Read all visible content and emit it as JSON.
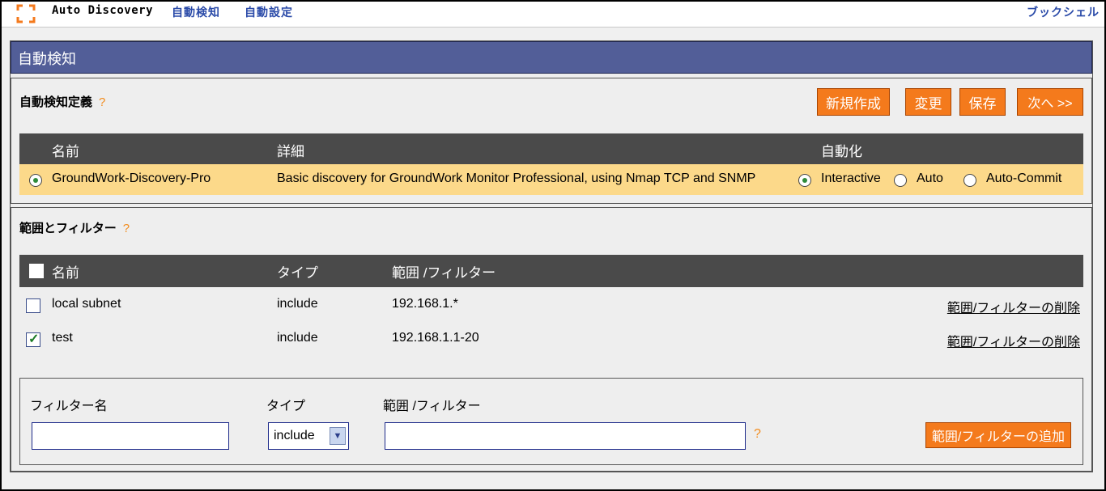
{
  "header": {
    "app_title": "Auto Discovery",
    "nav": [
      "自動検知",
      "自動設定"
    ],
    "bookshelf": "ブックシェル"
  },
  "page_title": "自動検知",
  "definition": {
    "title": "自動検知定義",
    "help": "?",
    "buttons": {
      "new": "新規作成",
      "edit": "変更",
      "save": "保存",
      "next": "次へ >>"
    },
    "columns": {
      "name": "名前",
      "detail": "詳細",
      "automation": "自動化"
    },
    "row": {
      "name": "GroundWork-Discovery-Pro",
      "detail": "Basic discovery for GroundWork Monitor Professional, using Nmap TCP and SNMP",
      "modes": [
        "Interactive",
        "Auto",
        "Auto-Commit"
      ],
      "selected_mode": "Interactive"
    }
  },
  "filters": {
    "title": "範囲とフィルター",
    "help": "?",
    "columns": {
      "name": "名前",
      "type": "タイプ",
      "range": "範囲 /フィルター"
    },
    "rows": [
      {
        "name": "local subnet",
        "type": "include",
        "range": "192.168.1.*",
        "checked": false,
        "delete_label": "範囲/フィルターの削除"
      },
      {
        "name": "test",
        "type": "include",
        "range": "192.168.1.1-20",
        "checked": true,
        "delete_label": "範囲/フィルターの削除"
      }
    ],
    "add": {
      "name_label": "フィルター名",
      "type_label": "タイプ",
      "range_label": "範囲 /フィルター",
      "type_value": "include",
      "help": "?",
      "add_button": "範囲/フィルターの追加"
    }
  },
  "colors": {
    "accent_orange": "#f47a1c",
    "title_blue": "#525e98",
    "header_dark": "#4a4a4a",
    "selected_row": "#fcd98a"
  }
}
